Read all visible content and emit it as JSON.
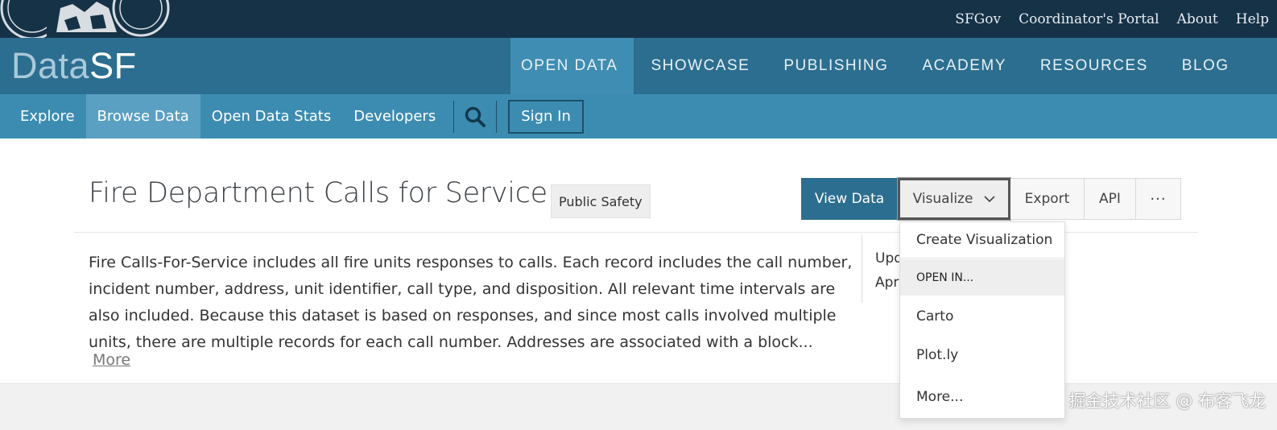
{
  "top_links": [
    "SFGov",
    "Coordinator's Portal",
    "About",
    "Help"
  ],
  "logo": {
    "part1": "Data",
    "part2": "SF"
  },
  "main_nav": [
    {
      "label": "OPEN DATA",
      "active": true
    },
    {
      "label": "SHOWCASE",
      "active": false
    },
    {
      "label": "PUBLISHING",
      "active": false
    },
    {
      "label": "ACADEMY",
      "active": false
    },
    {
      "label": "RESOURCES",
      "active": false
    },
    {
      "label": "BLOG",
      "active": false
    }
  ],
  "sub_nav": [
    {
      "label": "Explore",
      "active": false
    },
    {
      "label": "Browse Data",
      "active": true
    },
    {
      "label": "Open Data Stats",
      "active": false
    },
    {
      "label": "Developers",
      "active": false
    }
  ],
  "sign_in_label": "Sign In",
  "dataset": {
    "title": "Fire Department Calls for Service",
    "category": "Public Safety",
    "description": "Fire Calls-For-Service includes all fire units responses to calls. Each record includes the call number, incident number, address, unit identifier, call type, and disposition. All relevant time intervals are also included. Because this dataset is based on responses, and since most calls involved multiple units, there are multiple records for each call number. Addresses are associated with a block...",
    "more_label": "More",
    "updated_label": "Upd",
    "updated_value": "Apr"
  },
  "actions": {
    "view_data": "View Data",
    "visualize": "Visualize",
    "export": "Export",
    "api": "API",
    "more": "···"
  },
  "visualize_menu": {
    "create": "Create Visualization",
    "open_in_header": "OPEN IN...",
    "items": [
      "Carto",
      "Plot.ly",
      "More..."
    ]
  },
  "watermark": "掘金技术社区 @ 布客飞龙",
  "colors": {
    "top_bar": "#163247",
    "main_bar": "#2c6e8f",
    "sub_bar": "#3c8cb2",
    "active_tab": "#3f8db2"
  }
}
